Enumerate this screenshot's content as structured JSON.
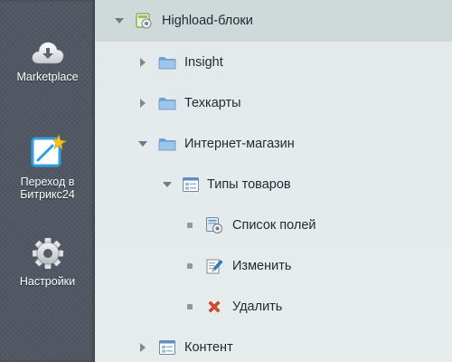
{
  "sidebar": {
    "items": [
      {
        "id": "marketplace",
        "label": "Marketplace",
        "icon": "cloud-download-icon"
      },
      {
        "id": "transition",
        "label": "Переход в Битрикс24",
        "icon": "bitrix24-magic-icon"
      },
      {
        "id": "settings",
        "label": "Настройки",
        "icon": "gear-icon"
      }
    ]
  },
  "tree": {
    "nodes": [
      {
        "label": "Highload-блоки",
        "state": "expanded",
        "icon": "highload-block-icon",
        "selected": true
      },
      {
        "label": "Insight",
        "state": "collapsed",
        "icon": "folder-icon"
      },
      {
        "label": "Техкарты",
        "state": "collapsed",
        "icon": "folder-icon"
      },
      {
        "label": "Интернет-магазин",
        "state": "expanded",
        "icon": "folder-icon"
      },
      {
        "label": "Типы товаров",
        "state": "expanded",
        "icon": "list-window-icon"
      },
      {
        "label": "Список полей",
        "state": "leaf",
        "icon": "fields-list-icon"
      },
      {
        "label": "Изменить",
        "state": "leaf",
        "icon": "edit-pencil-icon"
      },
      {
        "label": "Удалить",
        "state": "leaf",
        "icon": "delete-x-icon"
      },
      {
        "label": "Контент",
        "state": "collapsed",
        "icon": "list-window-icon"
      }
    ]
  },
  "colors": {
    "sidebar_bg": "#515863",
    "tree_bg": "#e6ecec",
    "selected_row": "#d0d9da",
    "accent_blue": "#2f9fe0",
    "delete_red": "#e04a2f"
  }
}
